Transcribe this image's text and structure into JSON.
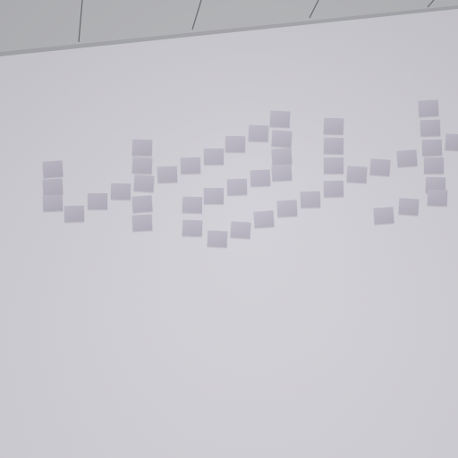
{
  "scene": {
    "subject": "sticky-notes-on-wall",
    "colors": {
      "wall": "#cfced4",
      "ceiling": "#b4b5b8",
      "ceiling_seam": "#6f7074",
      "note": "#b3b0bd"
    }
  }
}
